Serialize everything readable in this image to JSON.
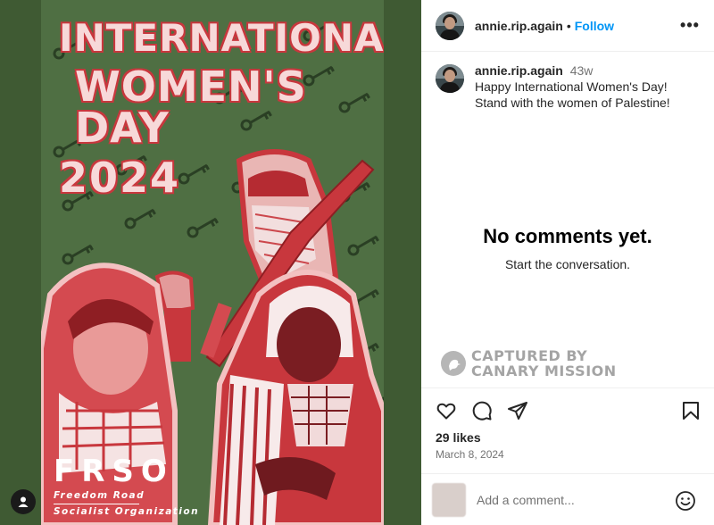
{
  "post": {
    "username": "annie.rip.again",
    "follow_label": "Follow",
    "separator": "•",
    "more_label": "•••"
  },
  "caption": {
    "username": "annie.rip.again",
    "age": "43w",
    "text": "Happy International Women's Day! Stand with the women of Palestine!"
  },
  "comments": {
    "empty_title": "No comments yet.",
    "empty_subtitle": "Start the conversation."
  },
  "watermark": {
    "line1": "CAPTURED BY",
    "line2": "CANARY MISSION"
  },
  "engagement": {
    "likes": "29 likes",
    "date": "March 8, 2024"
  },
  "comment_box": {
    "placeholder": "Add a comment..."
  },
  "poster": {
    "title_line1": "INTERNATIONAL",
    "title_line2": "WOMEN'S DAY",
    "title_line3": "2024",
    "org_abbr": "FRSO",
    "org_name_line1": "Freedom Road",
    "org_name_line2": "Socialist Organization"
  },
  "colors": {
    "follow_blue": "#0095f6",
    "poster_green": "#4f6f43",
    "poster_red": "#c8373d",
    "media_bg": "#3f5a33"
  },
  "icons": [
    "heart-icon",
    "comment-icon",
    "share-icon",
    "bookmark-icon",
    "emoji-icon",
    "more-icon",
    "user-tag-icon",
    "canary-logo-icon"
  ]
}
